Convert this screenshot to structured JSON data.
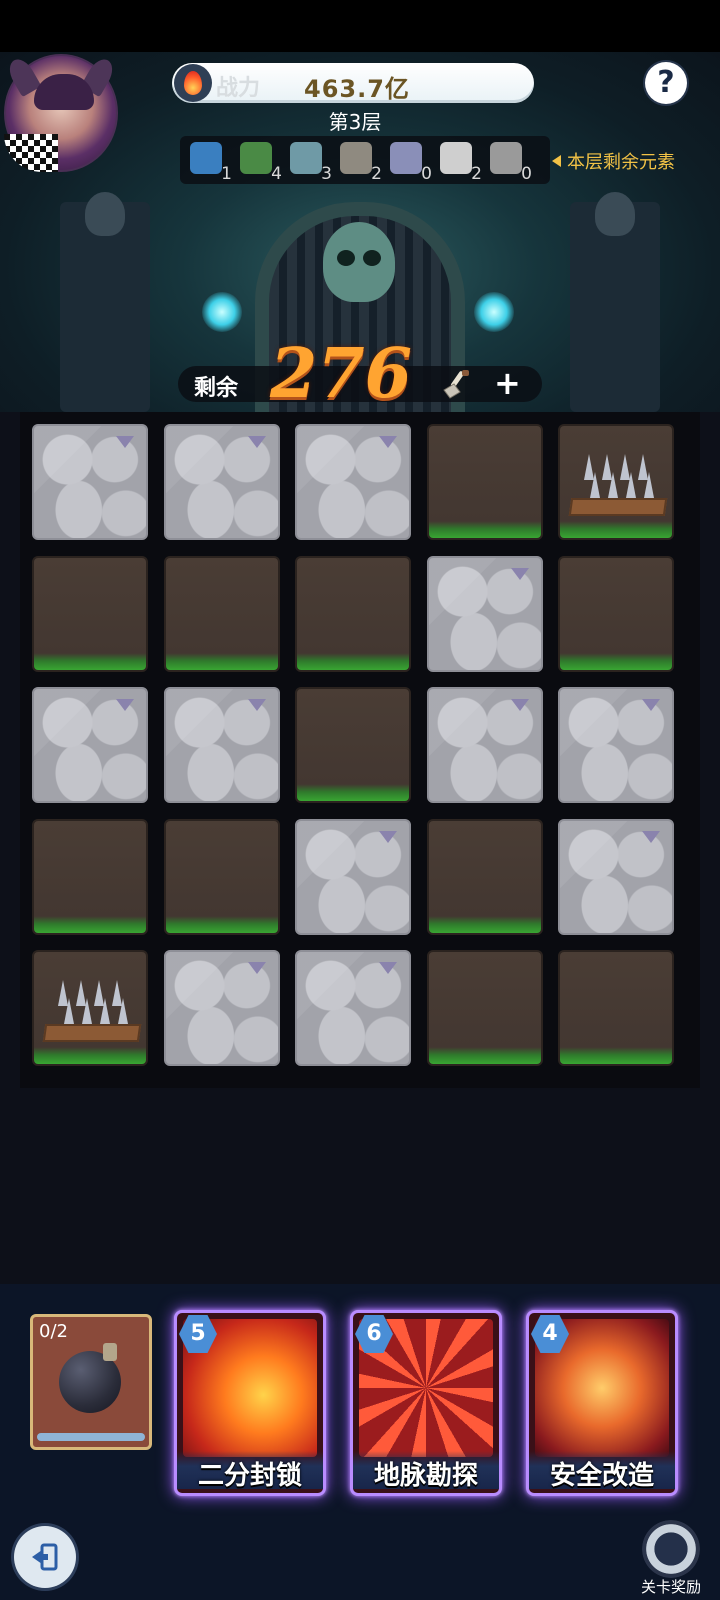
{
  "header": {
    "power_label": "战力",
    "power_value": "463.7亿",
    "floor": "第3层",
    "help_label": "?"
  },
  "elements": {
    "items": [
      {
        "icon": "portal-icon",
        "count": "1",
        "color": "#3a7fc0"
      },
      {
        "icon": "forbidden-icon",
        "count": "4",
        "color": "#4a8a45"
      },
      {
        "icon": "locked-chest-icon",
        "count": "3",
        "color": "#6f9aa6"
      },
      {
        "icon": "pickaxe-icon",
        "count": "2",
        "color": "#8f8a80"
      },
      {
        "icon": "crossed-swords-icon",
        "count": "0",
        "color": "#8a8fb8"
      },
      {
        "icon": "spiderweb-icon",
        "count": "2",
        "color": "#cfcfcf"
      },
      {
        "icon": "puzzle-icon",
        "count": "0",
        "color": "#9a9a9a"
      }
    ],
    "remaining_label": "本层剩余元素"
  },
  "remaining": {
    "label": "剩余",
    "value": "276",
    "add_label": "+"
  },
  "grid": [
    [
      "stone",
      "stone",
      "stone",
      "dirt",
      "spikes"
    ],
    [
      "dirt",
      "dirt",
      "dirt",
      "stone",
      "dirt"
    ],
    [
      "stone",
      "stone",
      "dirt",
      "stone",
      "stone"
    ],
    [
      "dirt",
      "dirt",
      "stone",
      "dirt",
      "stone"
    ],
    [
      "spikes",
      "stone",
      "stone",
      "dirt",
      "dirt"
    ]
  ],
  "bomb": {
    "count": "0/2",
    "progress": 0.0
  },
  "skills": [
    {
      "name": "二分封锁",
      "cost": "5",
      "icon": "chain-icon"
    },
    {
      "name": "地脉勘探",
      "cost": "6",
      "icon": "four-arrows-icon"
    },
    {
      "name": "安全改造",
      "cost": "4",
      "icon": "shield-icon"
    }
  ],
  "footer": {
    "reward_label": "关卡奖励"
  },
  "colors": {
    "accent_orange": "#ffa431",
    "card_glow": "#9b5cff",
    "label_gold": "#f2c246"
  }
}
